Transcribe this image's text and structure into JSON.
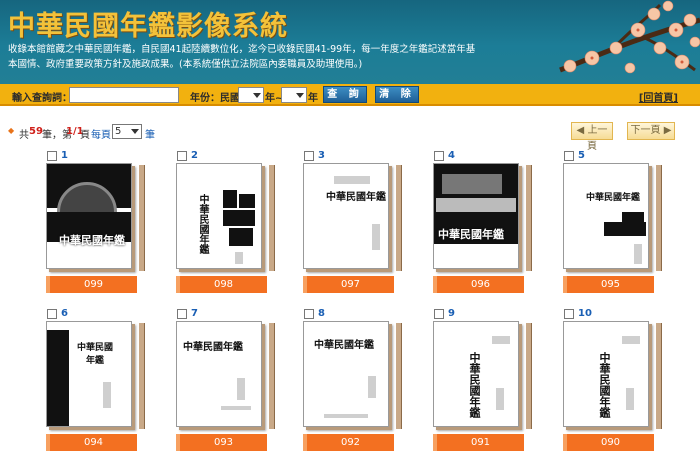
{
  "header": {
    "title": "中華民國年鑑影像系統",
    "description": "收錄本館館藏之中華民國年鑑，自民國41起陸續數位化，迄今已收錄民國41-99年，每一年度之年鑑記述當年基本國情、政府重要政策方針及施政成果。(本系統僅供立法院區內委職員及助理使用。)"
  },
  "search": {
    "query_label": "輸入查詢詞：",
    "query_value": "",
    "year_label": "年份：民國",
    "year_from": "",
    "sep": "年~",
    "year_to": "",
    "year_suffix": "年",
    "search_button": "查 詢",
    "clear_button": "清 除",
    "home_link": "[回首頁]"
  },
  "paging": {
    "total_prefix": "共",
    "total": "59",
    "total_suffix": "筆，第",
    "page": "1/1",
    "page_suffix": "頁",
    "per_page_label": "每頁",
    "per_page": "5",
    "per_page_suffix": "筆",
    "prev_button": "上一頁",
    "next_button": "下一頁"
  },
  "books": [
    {
      "index": "1",
      "year": "099",
      "cover_text": "中華民國年鑑"
    },
    {
      "index": "2",
      "year": "098",
      "cover_text": "中華民國年鑑"
    },
    {
      "index": "3",
      "year": "097",
      "cover_text": "中華民國年鑑"
    },
    {
      "index": "4",
      "year": "096",
      "cover_text": "中華民國年鑑"
    },
    {
      "index": "5",
      "year": "095",
      "cover_text": "中華民國年鑑"
    },
    {
      "index": "6",
      "year": "094",
      "cover_text": "中華民國年鑑"
    },
    {
      "index": "7",
      "year": "093",
      "cover_text": "中華民國年鑑"
    },
    {
      "index": "8",
      "year": "092",
      "cover_text": "中華民國年鑑"
    },
    {
      "index": "9",
      "year": "091",
      "cover_text": "中華民國年鑑"
    },
    {
      "index": "10",
      "year": "090",
      "cover_text": "中華民國年鑑"
    }
  ],
  "colors": {
    "banner": "#1c7d97",
    "title": "#f3c23a",
    "searchbar": "#f2b10f",
    "year_bar": "#f37021"
  }
}
